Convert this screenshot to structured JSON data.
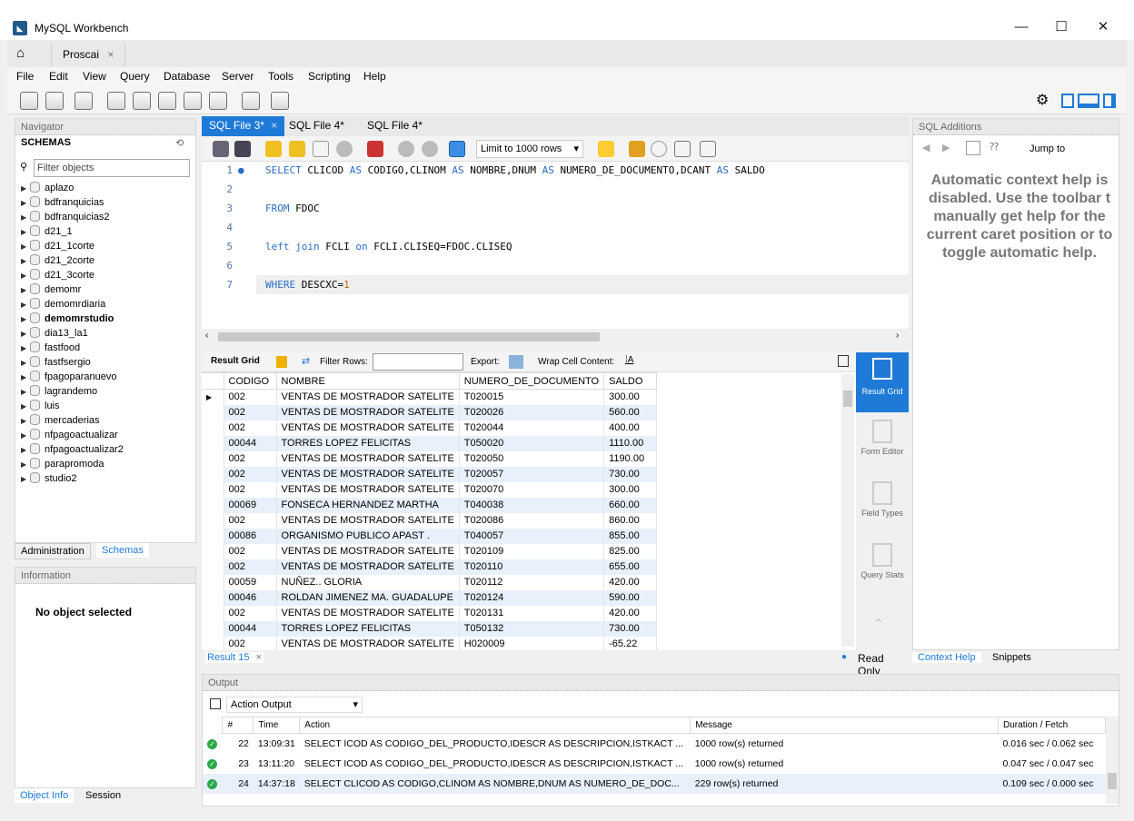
{
  "window": {
    "title": "MySQL Workbench",
    "minimize": "—",
    "maximize": "☐",
    "close": "✕"
  },
  "connection_tab": {
    "label": "Proscai",
    "close": "×"
  },
  "menu": [
    "File",
    "Edit",
    "View",
    "Query",
    "Database",
    "Server",
    "Tools",
    "Scripting",
    "Help"
  ],
  "navigator": {
    "title": "Navigator",
    "schemas_header": "SCHEMAS",
    "filter_placeholder": "Filter objects",
    "schemas": [
      "aplazo",
      "bdfranquicias",
      "bdfranquicias2",
      "d21_1",
      "d21_1corte",
      "d21_2corte",
      "d21_3corte",
      "demomr",
      "demomrdiaria",
      "demomrstudio",
      "dia13_la1",
      "fastfood",
      "fastfsergio",
      "fpagoparanuevo",
      "lagrandemo",
      "luis",
      "mercaderias",
      "nfpagoactualizar",
      "nfpagoactualizar2",
      "parapromoda",
      "studio2"
    ],
    "bold_schema": "demomrstudio",
    "tabs": [
      "Administration",
      "Schemas"
    ],
    "info_title": "Information",
    "no_object": "No object selected",
    "bottom_tabs": [
      "Object Info",
      "Session"
    ]
  },
  "editor": {
    "tabs": [
      {
        "label": "SQL File 3*",
        "close": "×"
      },
      {
        "label": "SQL File 4*"
      },
      {
        "label": "SQL File 4*"
      }
    ],
    "limit": "Limit to 1000 rows",
    "lines": [
      "1",
      "2",
      "3",
      "4",
      "5",
      "6",
      "7"
    ],
    "sql": {
      "l1_kw1": "SELECT",
      "l1_a": " CLICOD ",
      "l1_kw2": "AS",
      "l1_b": " CODIGO,CLINOM ",
      "l1_kw3": "AS",
      "l1_c": " NOMBRE,DNUM ",
      "l1_kw4": "AS",
      "l1_d": " NUMERO_DE_DOCUMENTO,DCANT ",
      "l1_kw5": "AS",
      "l1_e": " SALDO",
      "l3_kw": "FROM",
      "l3_a": " FDOC",
      "l5_kw1": "left join",
      "l5_a": " FCLI ",
      "l5_kw2": "on",
      "l5_b": " FCLI.CLISEQ=FDOC.CLISEQ",
      "l7_kw": "WHERE",
      "l7_a": " DESCXC=",
      "l7_num": "1"
    }
  },
  "result_toolbar": {
    "grid_label": "Result Grid",
    "filter_label": "Filter Rows:",
    "export_label": "Export:",
    "wrap_label": "Wrap Cell Content:"
  },
  "grid": {
    "columns": [
      "CODIGO",
      "NOMBRE",
      "NUMERO_DE_DOCUMENTO",
      "SALDO"
    ],
    "rows": [
      [
        "002",
        "VENTAS DE MOSTRADOR SATELITE",
        "T020015",
        "300.00"
      ],
      [
        "002",
        "VENTAS DE MOSTRADOR SATELITE",
        "T020026",
        "560.00"
      ],
      [
        "002",
        "VENTAS DE MOSTRADOR SATELITE",
        "T020044",
        "400.00"
      ],
      [
        "00044",
        "TORRES LOPEZ FELICITAS",
        "T050020",
        "1110.00"
      ],
      [
        "002",
        "VENTAS DE MOSTRADOR SATELITE",
        "T020050",
        "1190.00"
      ],
      [
        "002",
        "VENTAS DE MOSTRADOR SATELITE",
        "T020057",
        "730.00"
      ],
      [
        "002",
        "VENTAS DE MOSTRADOR SATELITE",
        "T020070",
        "300.00"
      ],
      [
        "00069",
        "FONSECA HERNANDEZ MARTHA",
        "T040038",
        "660.00"
      ],
      [
        "002",
        "VENTAS DE MOSTRADOR SATELITE",
        "T020086",
        "860.00"
      ],
      [
        "00086",
        "ORGANISMO PUBLICO APAST .",
        "T040057",
        "855.00"
      ],
      [
        "002",
        "VENTAS DE MOSTRADOR SATELITE",
        "T020109",
        "825.00"
      ],
      [
        "002",
        "VENTAS DE MOSTRADOR SATELITE",
        "T020110",
        "655.00"
      ],
      [
        "00059",
        "NUÑEZ.. GLORIA",
        "T020112",
        "420.00"
      ],
      [
        "00046",
        "ROLDAN JIMENEZ MA. GUADALUPE",
        "T020124",
        "590.00"
      ],
      [
        "002",
        "VENTAS DE MOSTRADOR SATELITE",
        "T020131",
        "420.00"
      ],
      [
        "00044",
        "TORRES LOPEZ FELICITAS",
        "T050132",
        "730.00"
      ],
      [
        "002",
        "VENTAS DE MOSTRADOR SATELITE",
        "H020009",
        "-65.22"
      ]
    ]
  },
  "side_views": [
    "Result Grid",
    "Form Editor",
    "Field Types",
    "Query Stats"
  ],
  "result_tab": {
    "label": "Result 15",
    "close": "×",
    "read_only": "Read Only"
  },
  "sql_additions": {
    "title": "SQL Additions",
    "jump_to": "Jump to",
    "help_text": "Automatic context help is disabled. Use the toolbar t manually get help for the current caret position or to toggle automatic help.",
    "tabs": [
      "Context Help",
      "Snippets"
    ]
  },
  "output": {
    "title": "Output",
    "selector": "Action Output",
    "columns": [
      "#",
      "Time",
      "Action",
      "Message",
      "Duration / Fetch"
    ],
    "rows": [
      [
        "22",
        "13:09:31",
        "SELECT ICOD AS CODIGO_DEL_PRODUCTO,IDESCR AS DESCRIPCION,ISTKACT ...",
        "1000 row(s) returned",
        "0.016 sec / 0.062 sec"
      ],
      [
        "23",
        "13:11:20",
        "SELECT ICOD AS CODIGO_DEL_PRODUCTO,IDESCR AS DESCRIPCION,ISTKACT ...",
        "1000 row(s) returned",
        "0.047 sec / 0.047 sec"
      ],
      [
        "24",
        "14:37:18",
        "SELECT CLICOD AS CODIGO,CLINOM AS NOMBRE,DNUM AS NUMERO_DE_DOC...",
        "229 row(s) returned",
        "0.109 sec / 0.000 sec"
      ]
    ]
  },
  "colors": {
    "accent": "#1e7ad6",
    "keyword": "#2b6cc4",
    "ok": "#2aa84a"
  }
}
